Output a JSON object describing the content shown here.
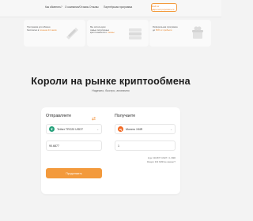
{
  "header": {
    "nav": [
      "Как обменять?",
      "О компании/Отзывы",
      "Отзывы",
      "Партнёрская программа"
    ],
    "login_label": "Войти/Зарегистрироваться"
  },
  "promos": [
    {
      "line1": "Программа для обмена",
      "line2": "бесплатно в",
      "accent": "течение 24 часов"
    },
    {
      "line1": "Мы используем",
      "line2": "самые популярные",
      "line3": "крипто-валюты и",
      "accent": "токены"
    },
    {
      "line1": "Реферальная программа",
      "line2": "до",
      "accent": "50% от прибыли"
    }
  ],
  "hero": {
    "title": "Короли на рынке криптообмена",
    "subtitle": "Надежно, быстро, анонимно"
  },
  "exchange": {
    "send_title": "Отправляете",
    "receive_title": "Получаете",
    "send_currency": "Tether TRC20 USDT",
    "receive_currency": "Monero XMR",
    "send_amount": "90.6877",
    "receive_amount": "1",
    "rate": "Курс: 90.6877 USDT = 1 XMR",
    "reserve": "Резерв: 330 XMR Не хватает?",
    "submit_label": "Продолжить"
  },
  "colors": {
    "accent": "#f39a3c",
    "usdt": "#26a17b",
    "xmr": "#f26822"
  }
}
